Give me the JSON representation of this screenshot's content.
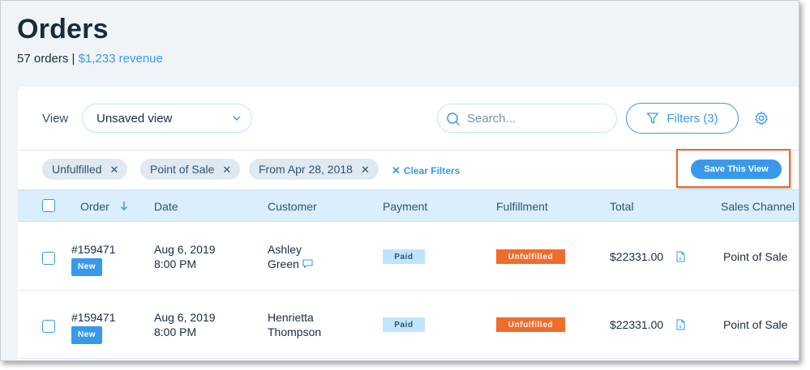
{
  "header": {
    "title": "Orders",
    "orders_count": "57 orders |",
    "revenue": "$1,233 revenue"
  },
  "toolbar": {
    "view_label": "View",
    "view_value": "Unsaved view",
    "search_placeholder": "Search...",
    "filters_label": "Filters (3)"
  },
  "filters": {
    "chips": [
      {
        "label": "Unfulfilled"
      },
      {
        "label": "Point of Sale"
      },
      {
        "label": "From Apr 28, 2018"
      }
    ],
    "clear_label": "Clear Filters",
    "save_view_label": "Save This View"
  },
  "table": {
    "columns": [
      "Order",
      "Date",
      "Customer",
      "Payment",
      "Fulfillment",
      "Total",
      "Sales Channel"
    ],
    "rows": [
      {
        "order": "#159471",
        "badge": "New",
        "date": "Aug 6, 2019",
        "time": "8:00 PM",
        "customer_first": "Ashley",
        "customer_last": "Green",
        "payment": "Paid",
        "fulfillment": "Unfulfilled",
        "total": "$22331.00",
        "channel": "Point of Sale"
      },
      {
        "order": "#159471",
        "badge": "New",
        "date": "Aug 6, 2019",
        "time": "8:00 PM",
        "customer_first": "Henrietta",
        "customer_last": "Thompson",
        "payment": "Paid",
        "fulfillment": "Unfulfilled",
        "total": "$22331.00",
        "channel": "Point of Sale"
      }
    ]
  },
  "colors": {
    "accent": "#3899ec",
    "highlight": "#e8692c",
    "unfulfilled": "#f06c2b"
  }
}
